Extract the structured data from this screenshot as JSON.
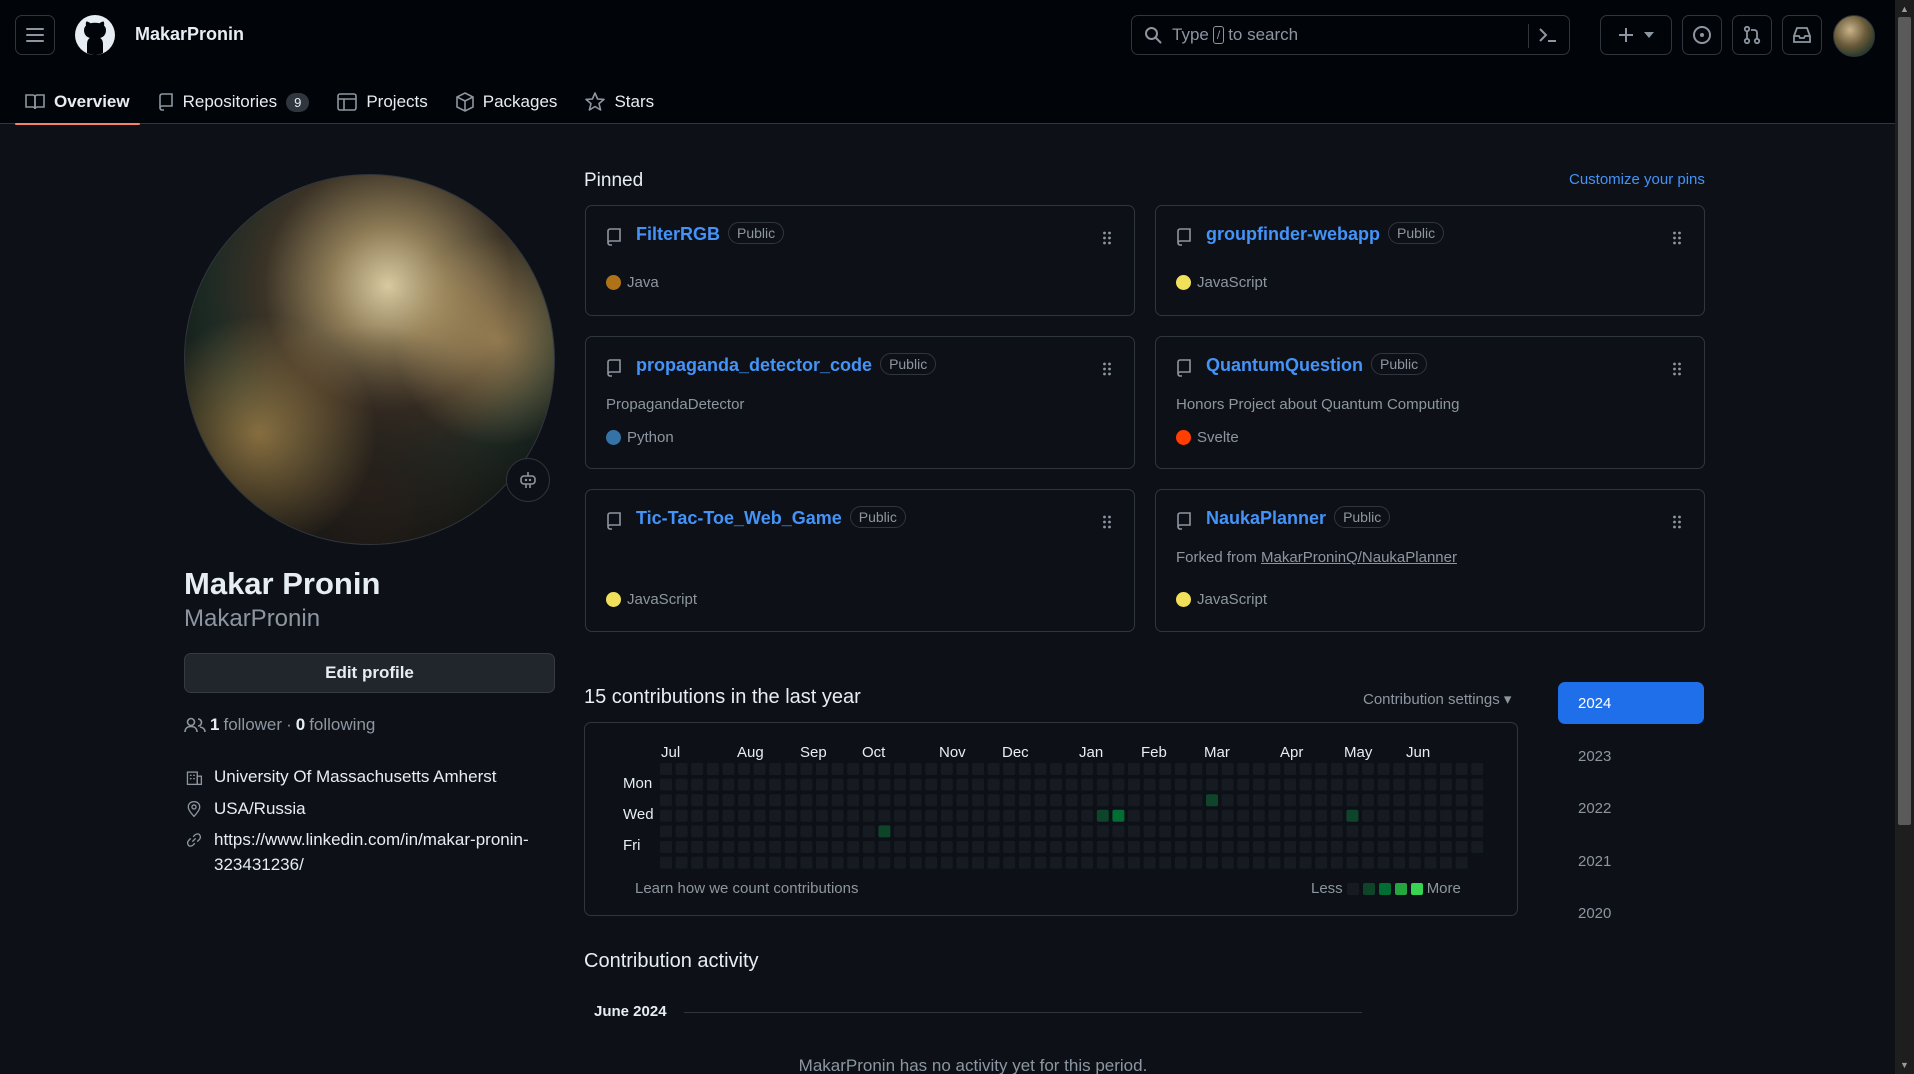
{
  "header": {
    "username": "MakarPronin",
    "search_prefix": "Type",
    "search_key": "/",
    "search_suffix": "to search"
  },
  "tabs": [
    {
      "label": "Overview"
    },
    {
      "label": "Repositories",
      "count": "9"
    },
    {
      "label": "Projects"
    },
    {
      "label": "Packages"
    },
    {
      "label": "Stars"
    }
  ],
  "profile": {
    "fullname": "Makar Pronin",
    "login": "MakarPronin",
    "edit_label": "Edit profile",
    "followers_count": "1",
    "followers_label": "follower",
    "separator": "·",
    "following_count": "0",
    "following_label": "following",
    "organization": "University Of Massachusetts Amherst",
    "location": "USA/Russia",
    "link_line1": "https://www.linkedin.com/in/makar-pronin-",
    "link_line2": "323431236/"
  },
  "pinned": {
    "title": "Pinned",
    "customize_label": "Customize your pins",
    "repos": [
      {
        "name": "FilterRGB",
        "visibility": "Public",
        "description": "",
        "language": "Java",
        "lang_color": "#b07219"
      },
      {
        "name": "groupfinder-webapp",
        "visibility": "Public",
        "description": "",
        "language": "JavaScript",
        "lang_color": "#f1e05a"
      },
      {
        "name": "propaganda_detector_code",
        "visibility": "Public",
        "description": "PropagandaDetector",
        "language": "Python",
        "lang_color": "#3572A5"
      },
      {
        "name": "QuantumQuestion",
        "visibility": "Public",
        "description": "Honors Project about Quantum Computing",
        "language": "Svelte",
        "lang_color": "#ff3e00"
      },
      {
        "name": "Tic-Tac-Toe_Web_Game",
        "visibility": "Public",
        "description": "",
        "language": "JavaScript",
        "lang_color": "#f1e05a"
      },
      {
        "name": "NaukaPlanner",
        "visibility": "Public",
        "forked_prefix": "Forked from",
        "forked_from": "MakarProninQ/NaukaPlanner",
        "language": "JavaScript",
        "lang_color": "#f1e05a"
      }
    ]
  },
  "contributions": {
    "title": "15 contributions in the last year",
    "settings_label": "Contribution settings",
    "months": [
      "Jul",
      "Aug",
      "Sep",
      "Oct",
      "Nov",
      "Dec",
      "Jan",
      "Feb",
      "Mar",
      "Apr",
      "May",
      "Jun"
    ],
    "day_labels": [
      "Mon",
      "Wed",
      "Fri"
    ],
    "learn_label": "Learn how we count contributions",
    "legend_less": "Less",
    "legend_more": "More",
    "colors": {
      "empty": "#161b22",
      "l1": "#0e4429",
      "l2": "#006d32",
      "l3": "#26a641",
      "l4": "#39d353"
    },
    "years": [
      "2024",
      "2023",
      "2022",
      "2021",
      "2020"
    ],
    "selected_year": "2024"
  },
  "activity": {
    "title": "Contribution activity",
    "month": "June 2024",
    "empty_message": "MakarPronin has no activity yet for this period."
  }
}
